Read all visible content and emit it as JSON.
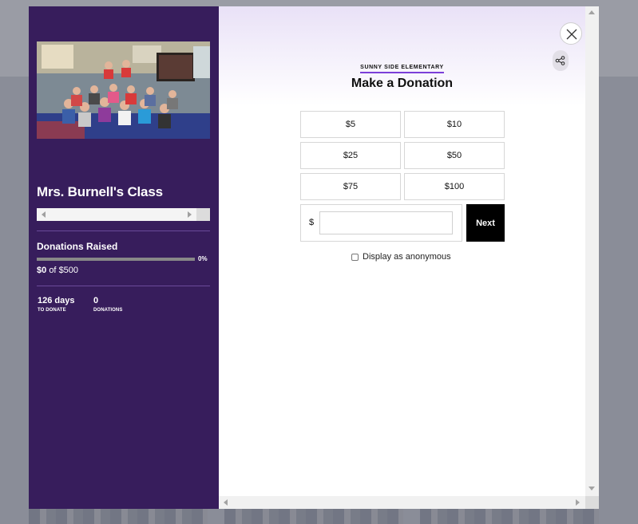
{
  "campaign": {
    "class_name": "Mrs. Burnell's Class",
    "photo_alt": "Class photo",
    "raised_label": "Donations Raised",
    "progress_fraction": 0,
    "progress_pct_text": "0%",
    "raised_amount": "$0",
    "of_text": "of",
    "goal_amount": "$500",
    "days_value": "126 days",
    "days_label": "TO DONATE",
    "donations_value": "0",
    "donations_label": "DONATIONS"
  },
  "donation": {
    "school_name": "SUNNY SIDE ELEMENTARY",
    "heading": "Make a Donation",
    "amount_options": [
      "$5",
      "$10",
      "$25",
      "$50",
      "$75",
      "$100"
    ],
    "currency_symbol": "$",
    "custom_value": "",
    "custom_placeholder": "",
    "next_label": "Next",
    "anonymous_label": "Display as anonymous"
  },
  "colors": {
    "sidebar_bg": "#371d5c",
    "accent": "#7b3fd8",
    "next_button": "#000000"
  },
  "icons": {
    "close": "close-icon",
    "share": "share-icon"
  }
}
